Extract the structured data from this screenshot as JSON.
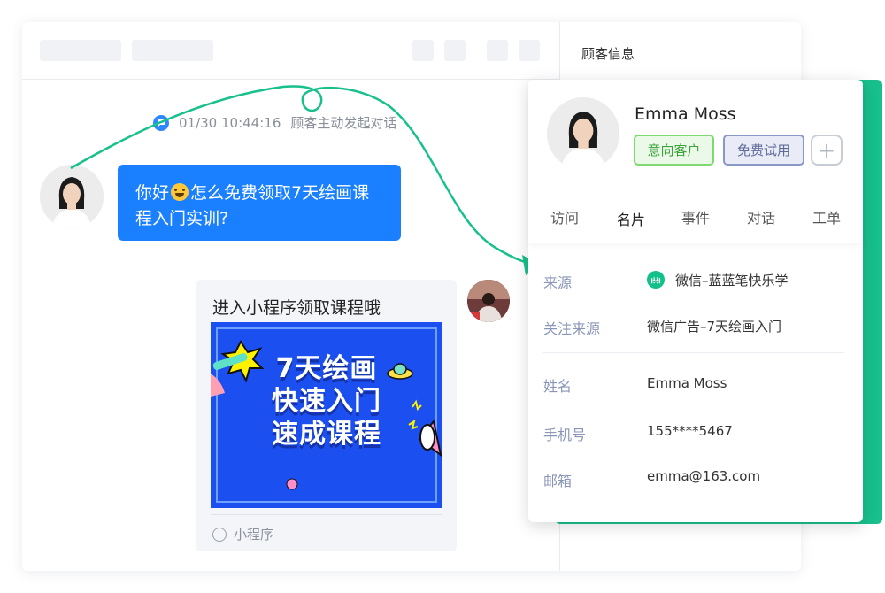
{
  "side_panel": {
    "title": "顾客信息"
  },
  "system_message": {
    "time": "01/30 10:44:16",
    "text": "顾客主动发起对话"
  },
  "messages": {
    "customer_before": "你好",
    "customer_after": "怎么免费领取7天绘画课程入门实训?"
  },
  "mini_card": {
    "title": "进入小程序领取课程哦",
    "banner_line1": "7天绘画",
    "banner_line2": "快速入门",
    "banner_line3": "速成课程",
    "footer": "小程序"
  },
  "profile": {
    "name": "Emma Moss",
    "tags": [
      "意向客户",
      "免费试用"
    ],
    "add_tag_label": "+",
    "tabs": [
      "访问",
      "名片",
      "事件",
      "对话",
      "工单"
    ],
    "active_tab": "名片",
    "fields": {
      "source": {
        "label": "来源",
        "value": "微信–蓝蓝笔快乐学",
        "icon_glyph": "ꗜ"
      },
      "follow_source": {
        "label": "关注来源",
        "value": "微信广告–7天绘画入门"
      },
      "name": {
        "label": "姓名",
        "value": "Emma Moss"
      },
      "phone": {
        "label": "手机号",
        "value": "155****5467"
      },
      "email": {
        "label": "邮箱",
        "value": "emma@163.com"
      }
    }
  },
  "colors": {
    "primary": "#1a80ff",
    "accent_green": "#17c08c",
    "tag_green": "#7dd970",
    "tag_blue": "#8a98c8"
  },
  "icons": {
    "system_message": "chat-bubble-icon",
    "mini_program": "mini-program-icon",
    "source": "wechat-source-icon"
  }
}
